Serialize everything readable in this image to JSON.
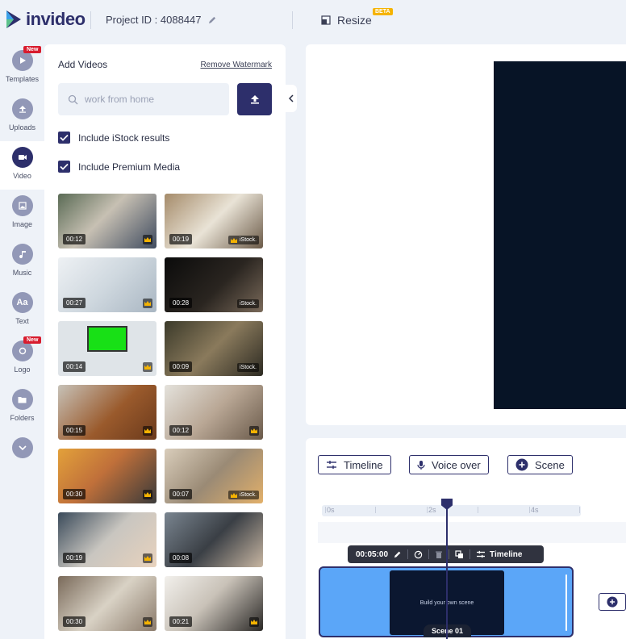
{
  "header": {
    "logo_text": "invideo",
    "project_id": "Project ID : 4088447",
    "resize_label": "Resize",
    "beta_badge": "BETA"
  },
  "rail": {
    "items": [
      {
        "label": "Templates",
        "icon": "play-icon",
        "badge": "New"
      },
      {
        "label": "Uploads",
        "icon": "upload-icon"
      },
      {
        "label": "Video",
        "icon": "video-camera-icon",
        "active": true
      },
      {
        "label": "Image",
        "icon": "image-icon"
      },
      {
        "label": "Music",
        "icon": "music-note-icon"
      },
      {
        "label": "Text",
        "icon": "text-icon",
        "glyph": "Aa"
      },
      {
        "label": "Logo",
        "icon": "logo-icon",
        "badge": "New"
      },
      {
        "label": "Folders",
        "icon": "folder-icon"
      }
    ]
  },
  "panel": {
    "title": "Add Videos",
    "remove_watermark": "Remove Watermark",
    "search_placeholder": "work from home",
    "checks": [
      "Include iStock results",
      "Include Premium Media"
    ],
    "istock_tag": "iStock.",
    "videos": [
      {
        "duration": "00:12",
        "badge": "crown"
      },
      {
        "duration": "00:19",
        "badge": "istock"
      },
      {
        "duration": "00:27",
        "badge": "crown"
      },
      {
        "duration": "00:28",
        "badge": "istock"
      },
      {
        "duration": "00:14",
        "badge": "crown"
      },
      {
        "duration": "00:09",
        "badge": "istock"
      },
      {
        "duration": "00:15",
        "badge": "crown"
      },
      {
        "duration": "00:12",
        "badge": "crown"
      },
      {
        "duration": "00:30",
        "badge": "crown"
      },
      {
        "duration": "00:07",
        "badge": "istock"
      },
      {
        "duration": "00:19",
        "badge": "crown"
      },
      {
        "duration": "00:08",
        "badge": "none"
      },
      {
        "duration": "00:30",
        "badge": "crown"
      },
      {
        "duration": "00:21",
        "badge": "crown"
      }
    ]
  },
  "timeline": {
    "buttons": [
      "Timeline",
      "Voice over",
      "Scene"
    ],
    "ruler_labels": [
      "0s",
      "2s",
      "4s"
    ],
    "toolbar_duration": "00:05:00",
    "toolbar_timeline": "Timeline",
    "scene_text": "Build your own scene",
    "scene_label": "Scene 01"
  },
  "colors": {
    "brand": "#2d2f6b",
    "accent_badge": "#d81c2e",
    "beta": "#f5b301",
    "clip": "#5ba6f8",
    "canvas": "#071426"
  }
}
